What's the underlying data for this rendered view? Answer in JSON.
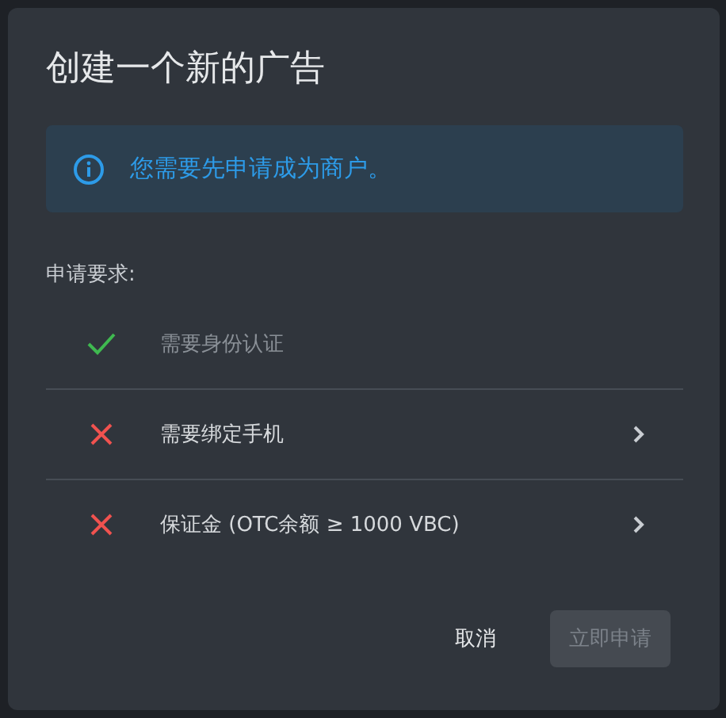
{
  "dialog": {
    "title": "创建一个新的广告",
    "alert": {
      "text": "您需要先申请成为商户。"
    },
    "requirements_label": "申请要求:",
    "requirements": [
      {
        "label": "需要身份认证",
        "met": true
      },
      {
        "label": "需要绑定手机",
        "met": false
      },
      {
        "label": "保证金 (OTC余额 ≥ 1000 VBC)",
        "met": false
      }
    ],
    "buttons": [
      {
        "label": "取消",
        "kind": "text",
        "disabled": false
      },
      {
        "label": "立即申请",
        "kind": "primary",
        "disabled": true
      }
    ]
  }
}
